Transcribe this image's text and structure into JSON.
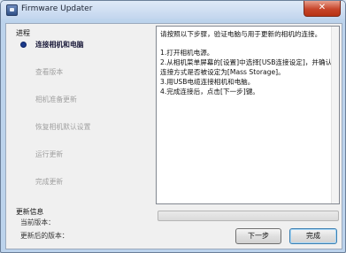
{
  "window": {
    "title": "Firmware Updater",
    "close_symbol": "✕"
  },
  "sidebar": {
    "section_title": "进程",
    "steps": [
      {
        "label": "连接相机和电脑",
        "active": true
      },
      {
        "label": "查看版本",
        "active": false
      },
      {
        "label": "相机准备更新",
        "active": false
      },
      {
        "label": "恢复相机默认设置",
        "active": false
      },
      {
        "label": "运行更新",
        "active": false
      },
      {
        "label": "完成更新",
        "active": false
      }
    ]
  },
  "instructions": {
    "lines": [
      "请按照以下步骤，验证电脑与用于更新的相机的连接。",
      "",
      "1.打开相机电源。",
      "2.从相机菜单屏幕的[设置]中选择[USB连接设定]，并确认连接方式是否被设定为[Mass Storage]。",
      "3.用USB电缆连接相机和电脑。",
      "4.完成连接后，点击[下一步]键。"
    ]
  },
  "update_info": {
    "title": "更新信息",
    "current_version_label": "当前版本：",
    "updated_version_label": "更新后的版本："
  },
  "progress": {
    "value": 0
  },
  "buttons": {
    "next_label": "下一步",
    "finish_label": "完成"
  },
  "colors": {
    "active_step": "#1a1a3a",
    "inactive_step": "#a0a0a0",
    "progress_fill": "#3cb83c"
  },
  "icons": {
    "app": "app-icon",
    "active_step": "bullet-icon",
    "close": "close-icon"
  }
}
